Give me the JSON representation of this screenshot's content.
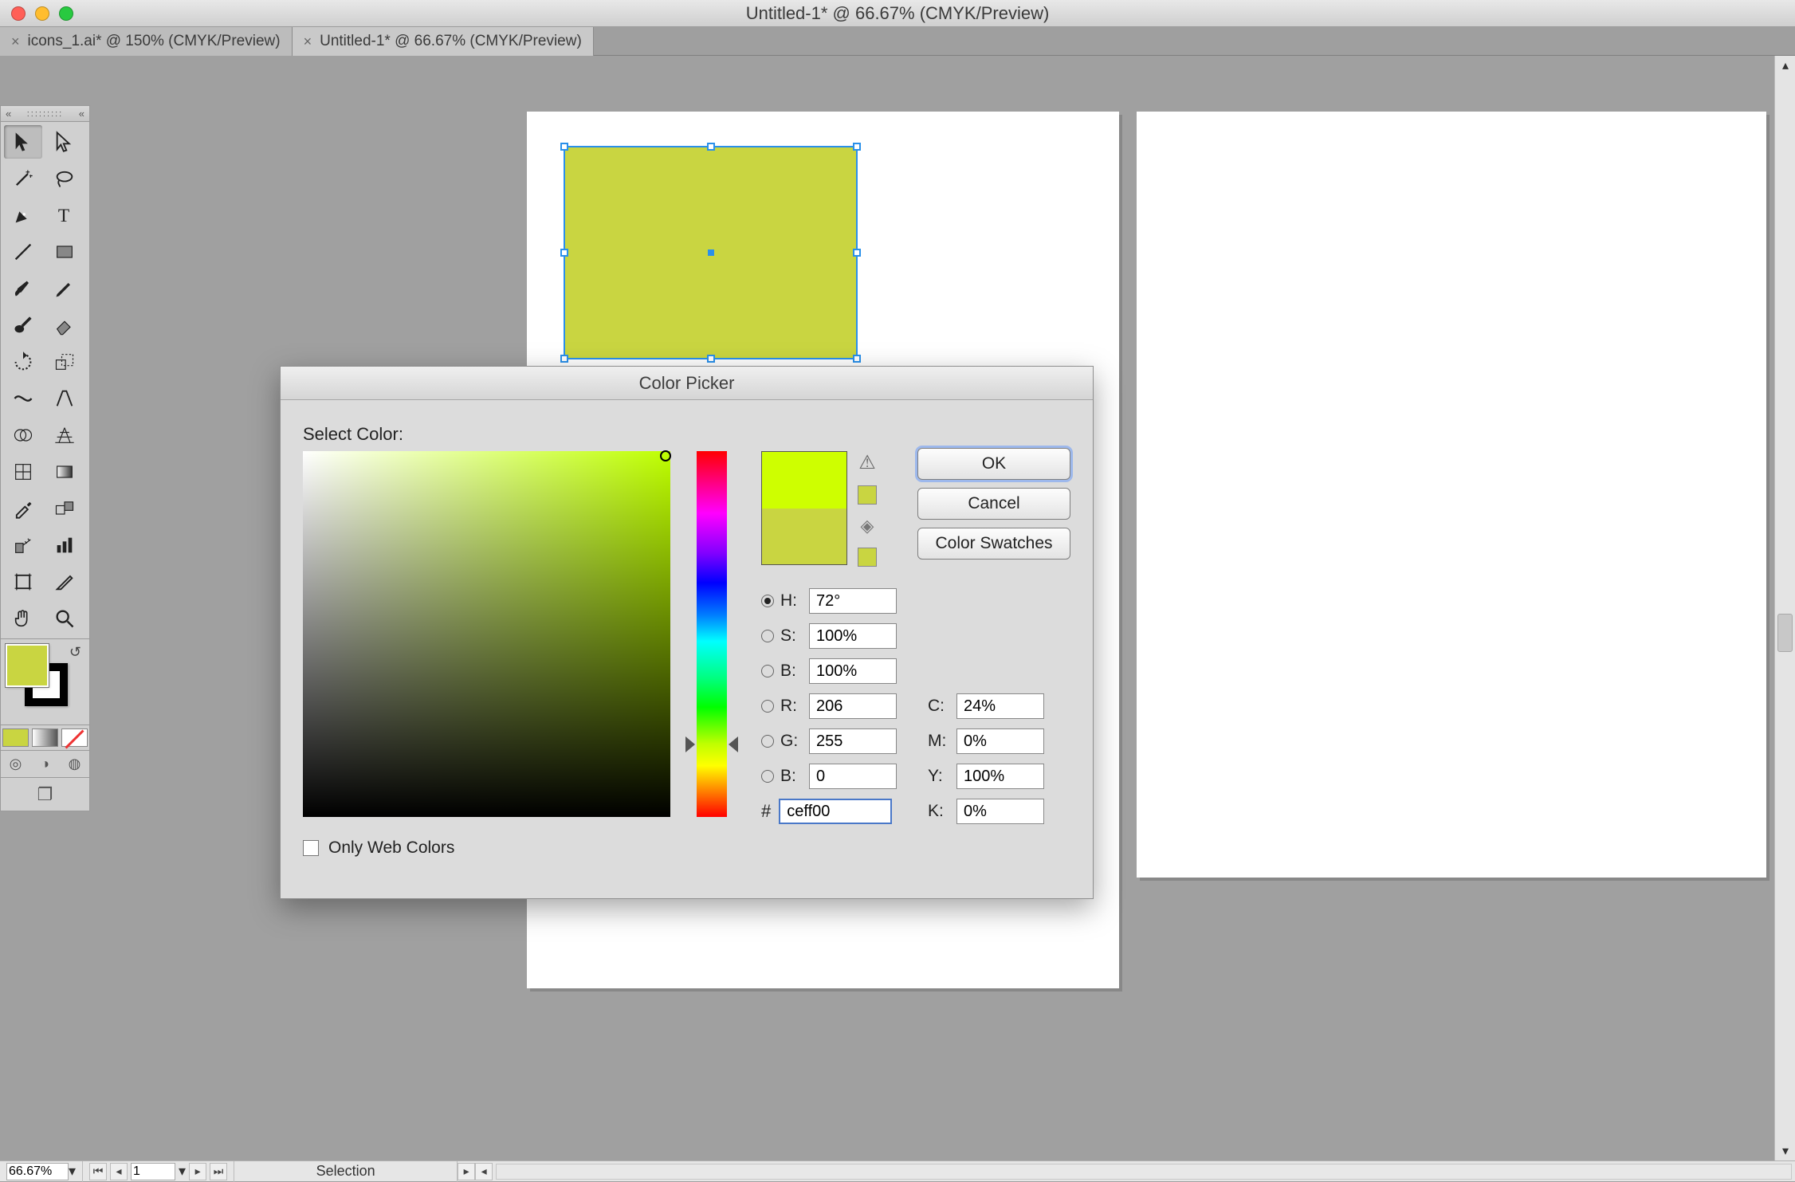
{
  "window": {
    "title": "Untitled-1* @ 66.67% (CMYK/Preview)"
  },
  "tabs": [
    {
      "label": "icons_1.ai* @ 150% (CMYK/Preview)",
      "active": false
    },
    {
      "label": "Untitled-1* @ 66.67% (CMYK/Preview)",
      "active": true
    }
  ],
  "selected_shape": {
    "fill": "#c9d541"
  },
  "tools": {
    "gripper": ":::::::::",
    "collapse": "«",
    "fill_color": "#c9d541",
    "stroke_color": "#000000"
  },
  "color_picker": {
    "title": "Color Picker",
    "select_label": "Select Color:",
    "new_color": "#ceff00",
    "current_color": "#c9d541",
    "safe_color": "#c9d541",
    "websafe_color": "#c9d541",
    "buttons": {
      "ok": "OK",
      "cancel": "Cancel",
      "swatches": "Color Swatches"
    },
    "hsb": {
      "h_label": "H:",
      "h": "72°",
      "s_label": "S:",
      "s": "100%",
      "b_label": "B:",
      "b": "100%"
    },
    "rgb": {
      "r_label": "R:",
      "r": "206",
      "g_label": "G:",
      "g": "255",
      "b_label": "B:",
      "b": "0"
    },
    "hex_label": "#",
    "hex": "ceff00",
    "cmyk": {
      "c_label": "C:",
      "c": "24%",
      "m_label": "M:",
      "m": "0%",
      "y_label": "Y:",
      "y": "100%",
      "k_label": "K:",
      "k": "0%"
    },
    "only_web_label": "Only Web Colors"
  },
  "status": {
    "zoom": "66.67%",
    "page": "1",
    "tool_name": "Selection"
  }
}
